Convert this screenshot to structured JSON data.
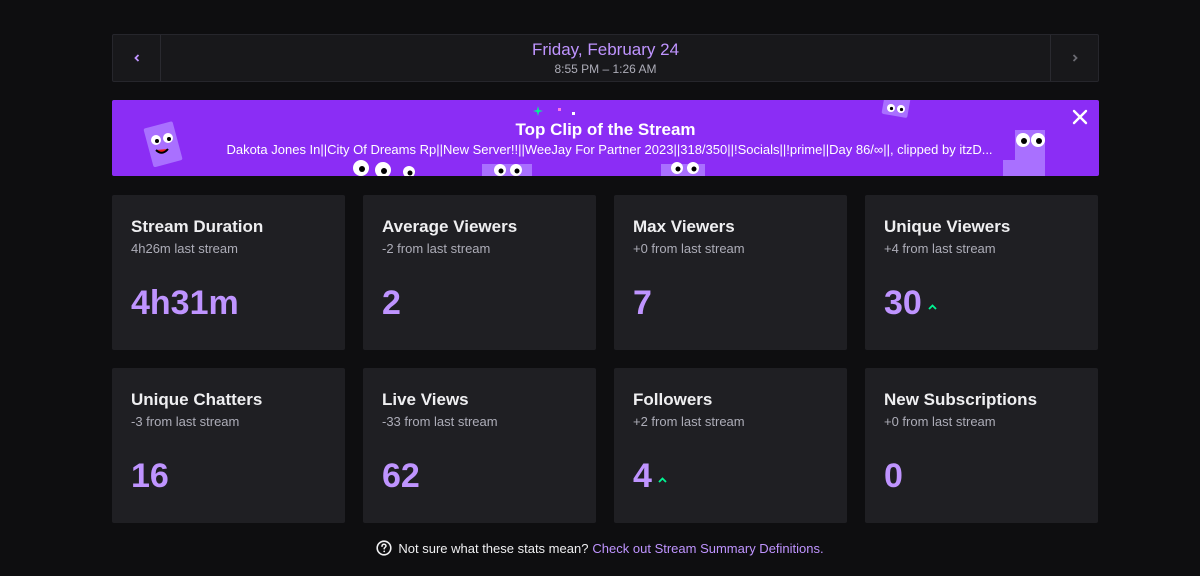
{
  "date_nav": {
    "title": "Friday, February 24",
    "time_range": "8:55 PM – 1:26 AM",
    "prev_icon": "chevron-left-icon",
    "next_icon": "chevron-right-icon"
  },
  "clip": {
    "title": "Top Clip of the Stream",
    "description": "Dakota Jones In||City Of Dreams Rp||New Server!!||WeeJay For Partner 2023||318/350||!Socials||!prime||Day 86/∞||, clipped by itzD...",
    "close_icon": "close-icon"
  },
  "stats": [
    {
      "title": "Stream Duration",
      "subtitle": "4h26m last stream",
      "value": "4h31m",
      "trend": ""
    },
    {
      "title": "Average Viewers",
      "subtitle": "-2 from last stream",
      "value": "2",
      "trend": ""
    },
    {
      "title": "Max Viewers",
      "subtitle": "+0 from last stream",
      "value": "7",
      "trend": ""
    },
    {
      "title": "Unique Viewers",
      "subtitle": "+4 from last stream",
      "value": "30",
      "trend": "up"
    },
    {
      "title": "Unique Chatters",
      "subtitle": "-3 from last stream",
      "value": "16",
      "trend": ""
    },
    {
      "title": "Live Views",
      "subtitle": "-33 from last stream",
      "value": "62",
      "trend": ""
    },
    {
      "title": "Followers",
      "subtitle": "+2 from last stream",
      "value": "4",
      "trend": "up"
    },
    {
      "title": "New Subscriptions",
      "subtitle": "+0 from last stream",
      "value": "0",
      "trend": ""
    }
  ],
  "footer": {
    "question": "Not sure what these stats mean?",
    "link": "Check out Stream Summary Definitions."
  },
  "colors": {
    "accent": "#bf94ff",
    "banner": "#8b2df5",
    "trend_up": "#00f593",
    "card": "#1f1f23",
    "background": "#0e0e10"
  }
}
